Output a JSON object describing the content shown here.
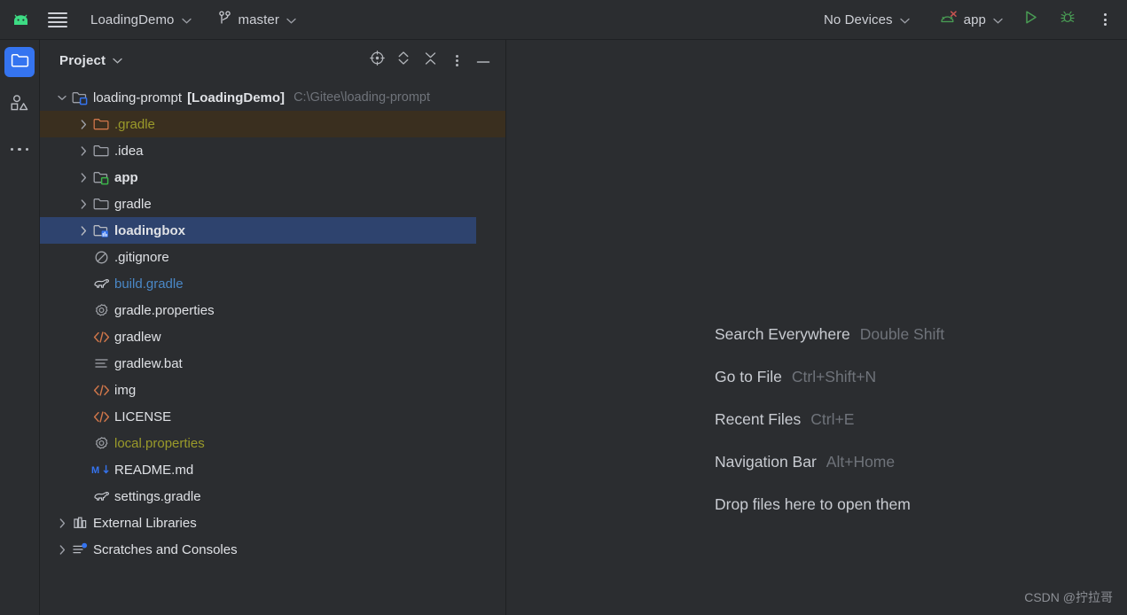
{
  "toolbar": {
    "logo_icon": "android-logo-icon",
    "menu_icon": "hamburger-menu-icon",
    "project_name": "LoadingDemo",
    "branch_icon": "git-branch-icon",
    "branch_name": "master",
    "device_selector": "No Devices",
    "run_config_icon": "android-app-error-icon",
    "run_config": "app",
    "run_icon": "run-play-icon",
    "debug_icon": "debug-bug-icon",
    "more_icon": "more-vertical-icon",
    "chevron": "⌄"
  },
  "stripe": {
    "items": [
      {
        "name": "project-tool-window",
        "icon": "folder-icon",
        "active": true
      },
      {
        "name": "resource-manager-tool-window",
        "icon": "shapes-icon",
        "active": false
      },
      {
        "name": "more-tool-windows",
        "icon": "more-horizontal-icon",
        "active": false
      }
    ]
  },
  "project_panel": {
    "title": "Project",
    "title_chevron": "⌄",
    "actions": [
      {
        "name": "select-opened-file-button",
        "icon": "crosshair-target-icon"
      },
      {
        "name": "expand-collapse-button",
        "icon": "chevron-up-down-icon"
      },
      {
        "name": "collapse-all-button",
        "icon": "collapse-all-x-icon"
      },
      {
        "name": "panel-options-button",
        "icon": "more-vertical-icon"
      },
      {
        "name": "hide-panel-button",
        "icon": "minimize-dash-icon"
      }
    ]
  },
  "tree": {
    "root": {
      "arrow": "⌄",
      "icon": "module-folder-blue-icon",
      "name": "loading-prompt",
      "module": "[LoadingDemo]",
      "path": "C:\\Gitee\\loading-prompt"
    },
    "nodes": [
      {
        "label": ".gradle",
        "icon": "folder-orange-icon",
        "arrow": "›",
        "state": "highlighted",
        "style": "ignored",
        "indent": 2
      },
      {
        "label": ".idea",
        "icon": "folder-icon",
        "arrow": "›",
        "state": "normal",
        "style": "normal",
        "indent": 2
      },
      {
        "label": "app",
        "icon": "module-folder-green-icon",
        "arrow": "›",
        "state": "normal",
        "style": "bold",
        "indent": 2
      },
      {
        "label": "gradle",
        "icon": "folder-icon",
        "arrow": "›",
        "state": "normal",
        "style": "normal",
        "indent": 2
      },
      {
        "label": "loadingbox",
        "icon": "module-folder-blue-icon",
        "arrow": "›",
        "state": "selected",
        "style": "bold",
        "indent": 2
      },
      {
        "label": ".gitignore",
        "icon": "gitignore-circle-slash-icon",
        "arrow": "",
        "state": "normal",
        "style": "normal",
        "indent": 2
      },
      {
        "label": "build.gradle",
        "icon": "gradle-elephant-icon",
        "arrow": "",
        "state": "normal",
        "style": "link",
        "indent": 2
      },
      {
        "label": "gradle.properties",
        "icon": "properties-gear-icon",
        "arrow": "",
        "state": "normal",
        "style": "normal",
        "indent": 2
      },
      {
        "label": "gradlew",
        "icon": "code-tag-icon",
        "arrow": "",
        "state": "normal",
        "style": "normal",
        "indent": 2
      },
      {
        "label": "gradlew.bat",
        "icon": "text-file-icon",
        "arrow": "",
        "state": "normal",
        "style": "normal",
        "indent": 2
      },
      {
        "label": "img",
        "icon": "code-tag-icon",
        "arrow": "",
        "state": "normal",
        "style": "normal",
        "indent": 2
      },
      {
        "label": "LICENSE",
        "icon": "code-tag-icon",
        "arrow": "",
        "state": "normal",
        "style": "normal",
        "indent": 2
      },
      {
        "label": "local.properties",
        "icon": "properties-gear-icon",
        "arrow": "",
        "state": "normal",
        "style": "ignored",
        "indent": 2
      },
      {
        "label": "README.md",
        "icon": "markdown-icon",
        "arrow": "",
        "state": "normal",
        "style": "normal",
        "indent": 2
      },
      {
        "label": "settings.gradle",
        "icon": "gradle-elephant-icon",
        "arrow": "",
        "state": "normal",
        "style": "normal",
        "indent": 2
      },
      {
        "label": "External Libraries",
        "icon": "libraries-icon",
        "arrow": "›",
        "state": "normal",
        "style": "normal",
        "indent": 1
      },
      {
        "label": "Scratches and Consoles",
        "icon": "scratches-icon",
        "arrow": "›",
        "state": "normal",
        "style": "normal",
        "indent": 1
      }
    ]
  },
  "editor": {
    "hints": [
      {
        "action": "Search Everywhere",
        "shortcut": "Double Shift"
      },
      {
        "action": "Go to File",
        "shortcut": "Ctrl+Shift+N"
      },
      {
        "action": "Recent Files",
        "shortcut": "Ctrl+E"
      },
      {
        "action": "Navigation Bar",
        "shortcut": "Alt+Home"
      },
      {
        "action": "Drop files here to open them",
        "shortcut": ""
      }
    ],
    "watermark": "CSDN @拧拉哥"
  },
  "colors": {
    "background": "#2b2d30",
    "selection": "#2e436e",
    "highlight_row": "#3a2f1f",
    "accent_blue": "#3574f0",
    "ignored_text": "#9a9a2a",
    "link_text": "#4a88c7",
    "muted_text": "#6f737a",
    "android_green": "#3ddc84",
    "folder_orange": "#cf764a"
  }
}
